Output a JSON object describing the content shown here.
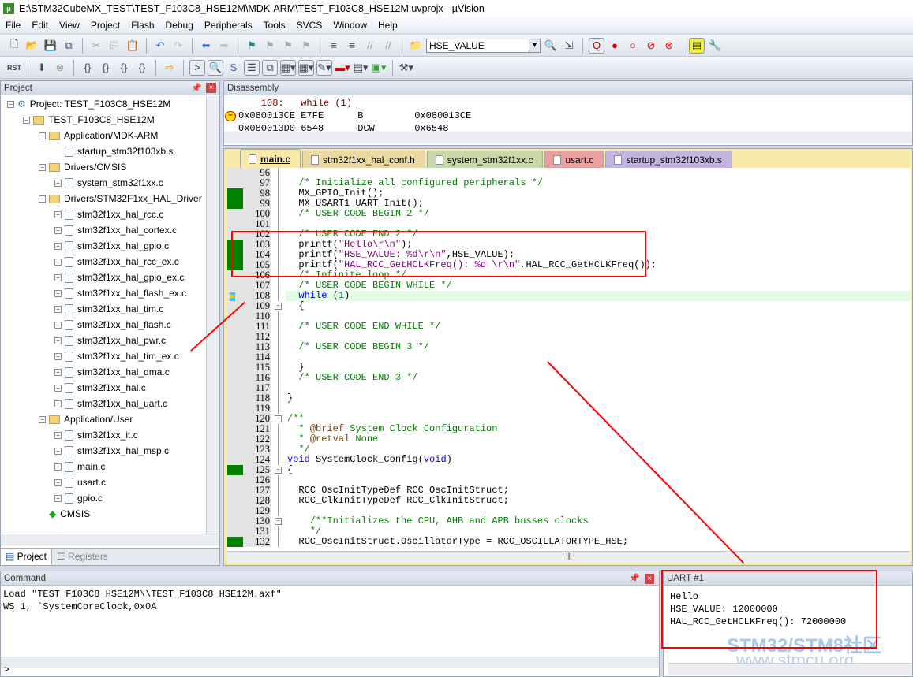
{
  "window": {
    "title": "E:\\STM32CubeMX_TEST\\TEST_F103C8_HSE12M\\MDK-ARM\\TEST_F103C8_HSE12M.uvprojx - µVision",
    "icon": "uvision-logo-icon"
  },
  "menu": [
    "File",
    "Edit",
    "View",
    "Project",
    "Flash",
    "Debug",
    "Peripherals",
    "Tools",
    "SVCS",
    "Window",
    "Help"
  ],
  "toolbar": {
    "find_value": "HSE_VALUE",
    "rst_label": "RST"
  },
  "project_panel": {
    "title": "Project",
    "tabs": [
      "Project",
      "Registers"
    ],
    "tree": [
      {
        "label": "Project: TEST_F103C8_HSE12M",
        "level": 0,
        "type": "project",
        "exp": "-"
      },
      {
        "label": "TEST_F103C8_HSE12M",
        "level": 1,
        "type": "target",
        "exp": "-"
      },
      {
        "label": "Application/MDK-ARM",
        "level": 2,
        "type": "folder",
        "exp": "-"
      },
      {
        "label": "startup_stm32f103xb.s",
        "level": 3,
        "type": "file",
        "exp": ""
      },
      {
        "label": "Drivers/CMSIS",
        "level": 2,
        "type": "folder",
        "exp": "-"
      },
      {
        "label": "system_stm32f1xx.c",
        "level": 3,
        "type": "file",
        "exp": "+"
      },
      {
        "label": "Drivers/STM32F1xx_HAL_Driver",
        "level": 2,
        "type": "folder",
        "exp": "-"
      },
      {
        "label": "stm32f1xx_hal_rcc.c",
        "level": 3,
        "type": "file",
        "exp": "+"
      },
      {
        "label": "stm32f1xx_hal_cortex.c",
        "level": 3,
        "type": "file",
        "exp": "+"
      },
      {
        "label": "stm32f1xx_hal_gpio.c",
        "level": 3,
        "type": "file",
        "exp": "+"
      },
      {
        "label": "stm32f1xx_hal_rcc_ex.c",
        "level": 3,
        "type": "file",
        "exp": "+"
      },
      {
        "label": "stm32f1xx_hal_gpio_ex.c",
        "level": 3,
        "type": "file",
        "exp": "+"
      },
      {
        "label": "stm32f1xx_hal_flash_ex.c",
        "level": 3,
        "type": "file",
        "exp": "+"
      },
      {
        "label": "stm32f1xx_hal_tim.c",
        "level": 3,
        "type": "file",
        "exp": "+"
      },
      {
        "label": "stm32f1xx_hal_flash.c",
        "level": 3,
        "type": "file",
        "exp": "+"
      },
      {
        "label": "stm32f1xx_hal_pwr.c",
        "level": 3,
        "type": "file",
        "exp": "+"
      },
      {
        "label": "stm32f1xx_hal_tim_ex.c",
        "level": 3,
        "type": "file",
        "exp": "+"
      },
      {
        "label": "stm32f1xx_hal_dma.c",
        "level": 3,
        "type": "file",
        "exp": "+"
      },
      {
        "label": "stm32f1xx_hal.c",
        "level": 3,
        "type": "file",
        "exp": "+"
      },
      {
        "label": "stm32f1xx_hal_uart.c",
        "level": 3,
        "type": "file",
        "exp": "+"
      },
      {
        "label": "Application/User",
        "level": 2,
        "type": "folder",
        "exp": "-"
      },
      {
        "label": "stm32f1xx_it.c",
        "level": 3,
        "type": "file",
        "exp": "+"
      },
      {
        "label": "stm32f1xx_hal_msp.c",
        "level": 3,
        "type": "file",
        "exp": "+"
      },
      {
        "label": "main.c",
        "level": 3,
        "type": "file",
        "exp": "+"
      },
      {
        "label": "usart.c",
        "level": 3,
        "type": "file",
        "exp": "+"
      },
      {
        "label": "gpio.c",
        "level": 3,
        "type": "file",
        "exp": "+"
      },
      {
        "label": "CMSIS",
        "level": 2,
        "type": "cmsis",
        "exp": ""
      }
    ]
  },
  "disassembly": {
    "title": "Disassembly",
    "lines": [
      {
        "text": "    108:   while (1)",
        "color": "#800000"
      },
      {
        "text": "0x080013CE E7FE      B         0x080013CE",
        "color": "#000"
      },
      {
        "text": "0x080013D0 6548      DCW       0x6548",
        "color": "#000"
      }
    ]
  },
  "editor": {
    "tabs": [
      {
        "label": "main.c",
        "color": "#f7e9a8",
        "active": true
      },
      {
        "label": "stm32f1xx_hal_conf.h",
        "color": "#ead9a0"
      },
      {
        "label": "system_stm32f1xx.c",
        "color": "#c9d8a8"
      },
      {
        "label": "usart.c",
        "color": "#eaa0a0"
      },
      {
        "label": "startup_stm32f103xb.s",
        "color": "#c4b4e0"
      }
    ],
    "lines": [
      {
        "n": "96",
        "segs": []
      },
      {
        "n": "97",
        "segs": [
          [
            "  /* Initialize all configured peripherals */",
            "c"
          ]
        ]
      },
      {
        "n": "98",
        "g": 1,
        "segs": [
          [
            "  MX_GPIO_Init();",
            "d"
          ]
        ]
      },
      {
        "n": "99",
        "g": 1,
        "segs": [
          [
            "  MX_USART1_UART_Init();",
            "d"
          ]
        ]
      },
      {
        "n": "100",
        "segs": [
          [
            "  /* USER CODE BEGIN 2 */",
            "c"
          ]
        ]
      },
      {
        "n": "101",
        "segs": []
      },
      {
        "n": "102",
        "segs": [
          [
            "  /* USER CODE END 2 */",
            "c"
          ]
        ]
      },
      {
        "n": "103",
        "g": 1,
        "segs": [
          [
            "  printf(",
            "d"
          ],
          [
            "\"Hello\\r\\n\"",
            "s"
          ],
          [
            ");",
            "d"
          ]
        ]
      },
      {
        "n": "104",
        "g": 1,
        "segs": [
          [
            "  printf(",
            "d"
          ],
          [
            "\"HSE_VALUE: %d\\r\\n\"",
            "s"
          ],
          [
            ",HSE_VALUE);",
            "d"
          ]
        ]
      },
      {
        "n": "105",
        "g": 1,
        "segs": [
          [
            "  printf(",
            "d"
          ],
          [
            "\"HAL_RCC_GetHCLKFreq(): %d \\r\\n\"",
            "s"
          ],
          [
            ",HAL_RCC_GetHCLKFreq());",
            "d"
          ]
        ]
      },
      {
        "n": "106",
        "segs": [
          [
            "  /* Infinite loop */",
            "c"
          ]
        ]
      },
      {
        "n": "107",
        "segs": [
          [
            "  /* USER CODE BEGIN WHILE */",
            "c"
          ]
        ]
      },
      {
        "n": "108",
        "cur": 1,
        "segs": [
          [
            "  while ",
            "k"
          ],
          [
            "(",
            "d"
          ],
          [
            "1",
            "n"
          ],
          [
            ")",
            "d"
          ]
        ]
      },
      {
        "n": "109",
        "fold": "-",
        "segs": [
          [
            "  {",
            "d"
          ]
        ]
      },
      {
        "n": "110",
        "segs": []
      },
      {
        "n": "111",
        "segs": [
          [
            "  /* USER CODE END WHILE */",
            "c"
          ]
        ]
      },
      {
        "n": "112",
        "segs": []
      },
      {
        "n": "113",
        "segs": [
          [
            "  /* USER CODE BEGIN 3 */",
            "c"
          ]
        ]
      },
      {
        "n": "114",
        "segs": []
      },
      {
        "n": "115",
        "segs": [
          [
            "  }",
            "d"
          ]
        ]
      },
      {
        "n": "116",
        "segs": [
          [
            "  /* USER CODE END 3 */",
            "c"
          ]
        ]
      },
      {
        "n": "117",
        "segs": []
      },
      {
        "n": "118",
        "segs": [
          [
            "}",
            "d"
          ]
        ]
      },
      {
        "n": "119",
        "segs": []
      },
      {
        "n": "120",
        "fold": "-",
        "segs": [
          [
            "/**",
            "c"
          ]
        ]
      },
      {
        "n": "121",
        "segs": [
          [
            "  * ",
            "c"
          ],
          [
            "@brief",
            "a"
          ],
          [
            " System Clock Configuration",
            "c"
          ]
        ]
      },
      {
        "n": "122",
        "segs": [
          [
            "  * ",
            "c"
          ],
          [
            "@retval",
            "a"
          ],
          [
            " None",
            "c"
          ]
        ]
      },
      {
        "n": "123",
        "segs": [
          [
            "  */",
            "c"
          ]
        ]
      },
      {
        "n": "124",
        "segs": [
          [
            "void",
            "k"
          ],
          [
            " SystemClock_Config(",
            "d"
          ],
          [
            "void",
            "k"
          ],
          [
            ")",
            "d"
          ]
        ]
      },
      {
        "n": "125",
        "g": 1,
        "fold": "-",
        "segs": [
          [
            "{",
            "d"
          ]
        ]
      },
      {
        "n": "126",
        "segs": []
      },
      {
        "n": "127",
        "segs": [
          [
            "  RCC_OscInitTypeDef RCC_OscInitStruct;",
            "d"
          ]
        ]
      },
      {
        "n": "128",
        "segs": [
          [
            "  RCC_ClkInitTypeDef RCC_ClkInitStruct;",
            "d"
          ]
        ]
      },
      {
        "n": "129",
        "segs": []
      },
      {
        "n": "130",
        "fold": "-",
        "segs": [
          [
            "    /**Initializes the CPU, AHB and APB busses clocks",
            "c"
          ]
        ]
      },
      {
        "n": "131",
        "segs": [
          [
            "    */",
            "c"
          ]
        ]
      },
      {
        "n": "132",
        "g": 1,
        "segs": [
          [
            "  RCC_OscInitStruct.OscillatorType = RCC_OSCILLATORTYPE_HSE;",
            "d"
          ]
        ]
      }
    ]
  },
  "command": {
    "title": "Command",
    "lines": [
      "Load \"TEST_F103C8_HSE12M\\\\TEST_F103C8_HSE12M.axf\"",
      "WS 1, `SystemCoreClock,0x0A"
    ],
    "prompt": ">"
  },
  "uart": {
    "title": "UART #1",
    "lines": [
      "Hello",
      "HSE_VALUE: 12000000",
      "HAL_RCC_GetHCLKFreq(): 72000000"
    ]
  },
  "watermark": {
    "line1": "STM32/STM8社区",
    "line2": "www.stmcu.org"
  }
}
